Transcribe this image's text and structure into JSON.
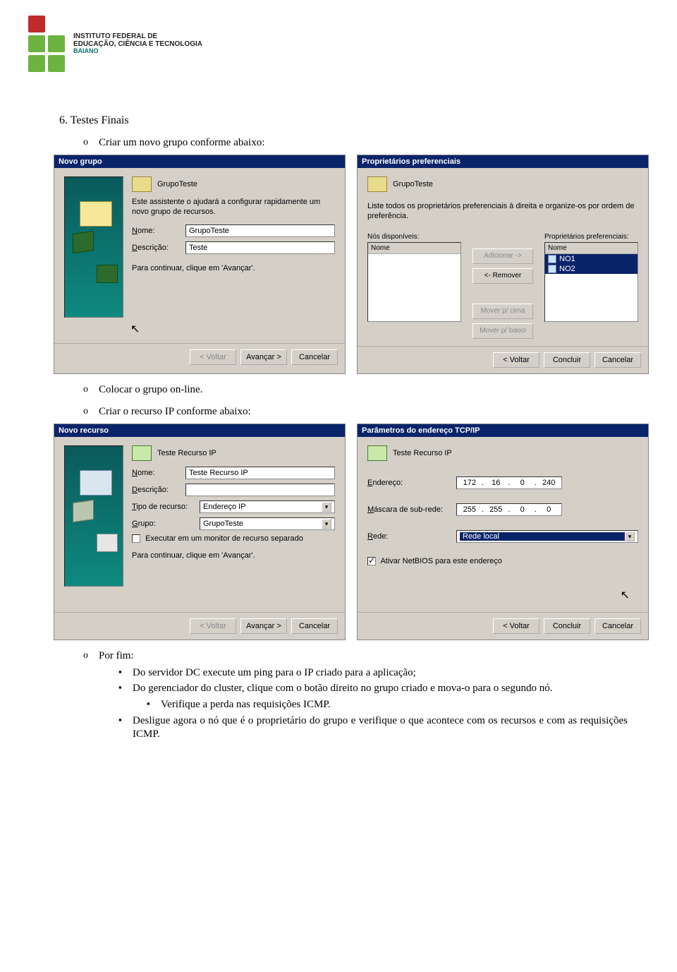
{
  "logo": {
    "line1": "INSTITUTO FEDERAL DE",
    "line2": "EDUCAÇÃO, CIÊNCIA E TECNOLOGIA",
    "sub": "BAIANO"
  },
  "section": {
    "title": "6. Testes Finais",
    "o1": "Criar um novo grupo conforme abaixo:",
    "o2": "Colocar o grupo on-line.",
    "o3": "Criar o recurso IP conforme abaixo:",
    "o4": "Por fim:",
    "s1": "Do servidor DC execute um ping para o IP criado para a aplicação;",
    "s2": "Do gerenciador do cluster, clique com o botão direito no grupo criado e mova-o para o segundo nó.",
    "s21": "Verifique a perda nas requisições ICMP.",
    "s3": "Desligue agora o nó que é o proprietário do grupo e verifique o que acontece com os recursos e com as requisições ICMP."
  },
  "wiz1": {
    "title": "Novo grupo",
    "htitle": "GrupoTeste",
    "help": "Este assistente o ajudará a configurar rapidamente um novo grupo de recursos.",
    "lbl_nome": "Nome:",
    "lbl_desc": "Descrição:",
    "nome": "GrupoTeste",
    "desc": "Teste",
    "cont": "Para continuar, clique em 'Avançar'.",
    "back": "< Voltar",
    "next": "Avançar >",
    "cancel": "Cancelar"
  },
  "wiz2": {
    "title": "Proprietários preferenciais",
    "htitle": "GrupoTeste",
    "help": "Liste todos os proprietários preferenciais à direita e organize-os por ordem de preferência.",
    "leftlbl": "Nós disponíveis:",
    "rightlbl": "Proprietários preferenciais:",
    "colname": "Nome",
    "btn_add": "Adicionar ->",
    "btn_rem": "<- Remover",
    "btn_up": "Mover p/ cima",
    "btn_down": "Mover p/ baixo",
    "n1": "NO1",
    "n2": "NO2",
    "back": "< Voltar",
    "finish": "Concluir",
    "cancel": "Cancelar"
  },
  "wiz3": {
    "title": "Novo recurso",
    "htitle": "Teste Recurso IP",
    "lbl_nome": "Nome:",
    "lbl_desc": "Descrição:",
    "lbl_tipo": "Tipo de recurso:",
    "lbl_grupo": "Grupo:",
    "nome": "Teste Recurso IP",
    "desc": "",
    "tipo": "Endereço IP",
    "grupo": "GrupoTeste",
    "chk": "Executar em um monitor de recurso separado",
    "cont": "Para continuar, clique em 'Avançar'.",
    "back": "< Voltar",
    "next": "Avançar >",
    "cancel": "Cancelar"
  },
  "wiz4": {
    "title": "Parâmetros do endereço TCP/IP",
    "htitle": "Teste Recurso IP",
    "lbl_end": "Endereço:",
    "lbl_mask": "Máscara de sub-rede:",
    "lbl_rede": "Rede:",
    "end": [
      "172",
      "16",
      "0",
      "240"
    ],
    "mask": [
      "255",
      "255",
      "0",
      "0"
    ],
    "rede": "Rede local",
    "chk": "Ativar NetBIOS para este endereço",
    "back": "< Voltar",
    "finish": "Concluir",
    "cancel": "Cancelar"
  },
  "chart_data": null
}
